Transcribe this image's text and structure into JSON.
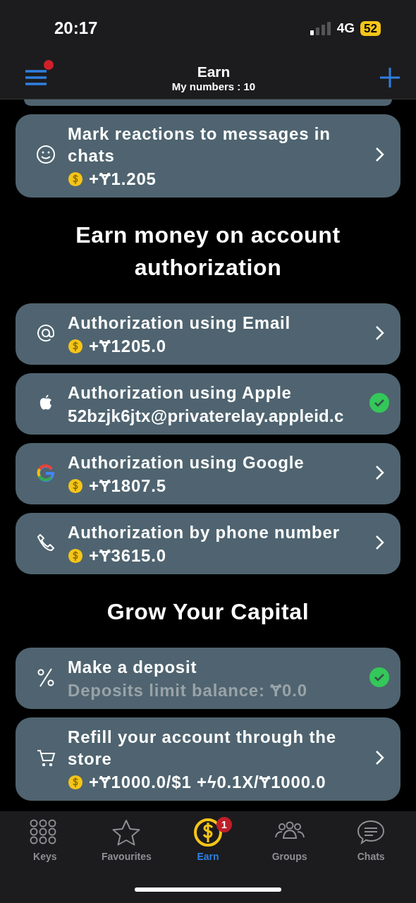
{
  "status_bar": {
    "time": "20:17",
    "network": "4G",
    "battery": "52"
  },
  "header": {
    "title": "Earn",
    "subtitle": "My numbers : 10",
    "menu_badge": true
  },
  "sections": [
    {
      "tasks": [
        {
          "kind": "smile",
          "title": "Mark reactions to messages in chats",
          "line": {
            "kind": "reward",
            "text": "+Ɏ1.205"
          },
          "completed": false
        }
      ]
    },
    {
      "heading": "Earn money on account authorization",
      "tasks": [
        {
          "kind": "at",
          "title": "Authorization using Email",
          "line": {
            "kind": "reward",
            "text": "+Ɏ1205.0"
          },
          "completed": false
        },
        {
          "kind": "apple",
          "title": "Authorization using Apple",
          "line": {
            "kind": "plain",
            "text": "52bzjk6jtx@privaterelay.appleid.c"
          },
          "completed": true
        },
        {
          "kind": "google",
          "title": "Authorization using Google",
          "line": {
            "kind": "reward",
            "text": "+Ɏ1807.5"
          },
          "completed": false
        },
        {
          "kind": "phone",
          "title": "Authorization by phone number",
          "line": {
            "kind": "reward",
            "text": "+Ɏ3615.0"
          },
          "completed": false
        }
      ]
    },
    {
      "heading": "Grow Your Capital",
      "tasks": [
        {
          "kind": "percent",
          "title": "Make a deposit",
          "line": {
            "kind": "muted",
            "text": "Deposits limit balance: Ɏ0.0"
          },
          "completed": true
        },
        {
          "kind": "cart",
          "title": "Refill your account through the store",
          "line": {
            "kind": "reward",
            "text": "+Ɏ1000.0/$1 +ϟ0.1X/Ɏ1000.0"
          },
          "completed": false
        }
      ]
    }
  ],
  "tab_bar": [
    {
      "kind": "keys",
      "label": "Keys",
      "selected": false
    },
    {
      "kind": "star",
      "label": "Favourites",
      "selected": false
    },
    {
      "kind": "coin",
      "label": "Earn",
      "selected": true,
      "badge": "1"
    },
    {
      "kind": "groups",
      "label": "Groups",
      "selected": false
    },
    {
      "kind": "chats",
      "label": "Chats",
      "selected": false
    }
  ]
}
